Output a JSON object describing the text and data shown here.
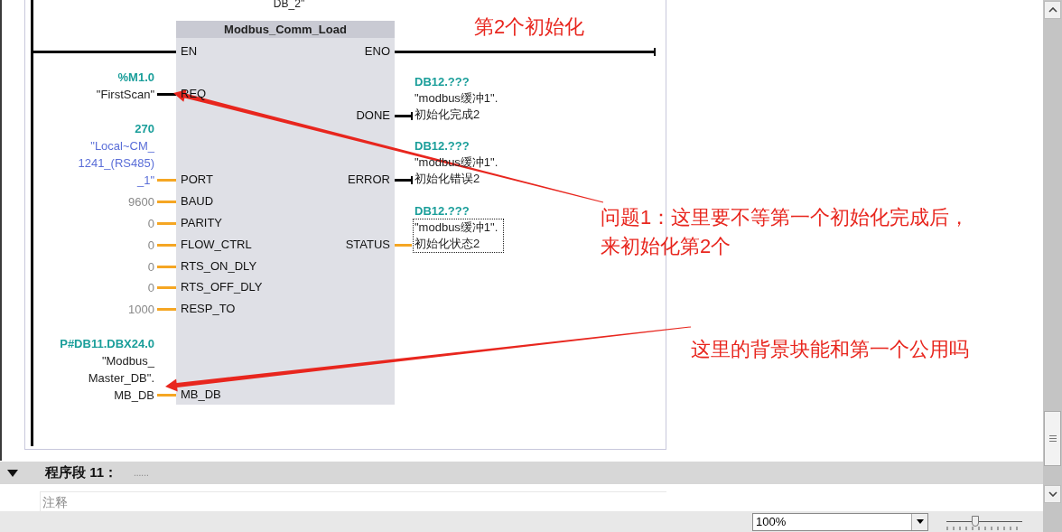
{
  "block": {
    "instance_name": "DB_2\"",
    "title": "Modbus_Comm_Load",
    "inputs": [
      {
        "pin": "EN",
        "kind": "bool"
      },
      {
        "pin": "REQ",
        "kind": "bool",
        "address": "%M1.0",
        "operand": [
          "\"FirstScan\""
        ],
        "color": "#222222"
      },
      {
        "pin": "PORT",
        "kind": "data",
        "address": "270",
        "operand": [
          "\"Local~CM_",
          "1241_(RS485)",
          "_1\""
        ],
        "color": "#5a6ed8"
      },
      {
        "pin": "BAUD",
        "kind": "data",
        "operand": [
          "9600"
        ],
        "color": "#888888"
      },
      {
        "pin": "PARITY",
        "kind": "data",
        "operand": [
          "0"
        ],
        "color": "#888888"
      },
      {
        "pin": "FLOW_CTRL",
        "kind": "data",
        "operand": [
          "0"
        ],
        "color": "#888888"
      },
      {
        "pin": "RTS_ON_DLY",
        "kind": "data",
        "operand": [
          "0"
        ],
        "color": "#888888"
      },
      {
        "pin": "RTS_OFF_DLY",
        "kind": "data",
        "operand": [
          "0"
        ],
        "color": "#888888"
      },
      {
        "pin": "RESP_TO",
        "kind": "data",
        "operand": [
          "1000"
        ],
        "color": "#888888"
      },
      {
        "pin": "MB_DB",
        "kind": "data",
        "address": "P#DB11.DBX24.0",
        "operand": [
          "\"Modbus_",
          "Master_DB\".",
          "MB_DB"
        ],
        "color": "#222222"
      }
    ],
    "outputs": [
      {
        "pin": "ENO",
        "kind": "bool"
      },
      {
        "pin": "DONE",
        "kind": "bool",
        "address": "DB12.???",
        "operand": [
          "\"modbus缓冲1\".",
          "初始化完成2"
        ],
        "selected": false
      },
      {
        "pin": "ERROR",
        "kind": "bool",
        "address": "DB12.???",
        "operand": [
          "\"modbus缓冲1\".",
          "初始化错误2"
        ],
        "selected": false
      },
      {
        "pin": "STATUS",
        "kind": "data",
        "address": "DB12.???",
        "operand": [
          "\"modbus缓冲1\".",
          "初始化状态2"
        ],
        "selected": true
      }
    ]
  },
  "annotations": [
    {
      "text": "第2个初始化"
    },
    {
      "text": "问题1：这里要不等第一个初始化完成后，"
    },
    {
      "text": "来初始化第2个"
    },
    {
      "text": "这里的背景块能和第一个公用吗"
    }
  ],
  "next_network": {
    "title": "程序段 11：",
    "comment_title": "......",
    "comment_placeholder": "注释",
    "expanded": true
  },
  "status_bar": {
    "zoom": "100%",
    "zoom_slider": {
      "level": 0.38
    }
  }
}
